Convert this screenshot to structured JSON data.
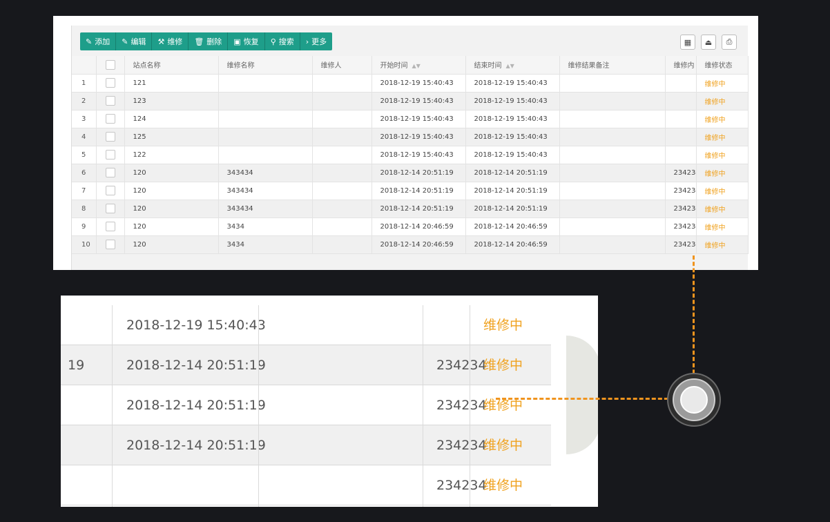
{
  "toolbar": [
    {
      "icon": "✎",
      "label": "添加",
      "name": "add-button",
      "icon_name": "pencil-icon"
    },
    {
      "icon": "✎",
      "label": "编辑",
      "name": "edit-button",
      "icon_name": "pencil-icon"
    },
    {
      "icon": "⚒",
      "label": "维修",
      "name": "repair-button",
      "icon_name": "wrench-icon"
    },
    {
      "icon": "🗑",
      "label": "删除",
      "name": "delete-button",
      "icon_name": "trash-icon"
    },
    {
      "icon": "▣",
      "label": "恢复",
      "name": "restore-button",
      "icon_name": "restore-icon"
    },
    {
      "icon": "⚲",
      "label": "搜索",
      "name": "search-button",
      "icon_name": "search-icon"
    },
    {
      "icon": "›",
      "label": "更多",
      "name": "more-button",
      "icon_name": "chevron-right-icon"
    }
  ],
  "right_tools": [
    {
      "icon": "▦",
      "name": "columns-button",
      "icon_name": "grid-icon"
    },
    {
      "icon": "⏏",
      "name": "export-button",
      "icon_name": "export-icon"
    },
    {
      "icon": "⎙",
      "name": "print-button",
      "icon_name": "print-icon"
    }
  ],
  "table": {
    "headers": [
      "",
      "",
      "站点名称",
      "维修名称",
      "维修人",
      "开始时间",
      "结束时间",
      "维修结果备注",
      "维修内",
      "维修状态"
    ],
    "rows": [
      [
        "1",
        "121",
        "",
        "",
        "2018-12-19 15:40:43",
        "2018-12-19 15:40:43",
        "",
        "",
        "维修中"
      ],
      [
        "2",
        "123",
        "",
        "",
        "2018-12-19 15:40:43",
        "2018-12-19 15:40:43",
        "",
        "",
        "维修中"
      ],
      [
        "3",
        "124",
        "",
        "",
        "2018-12-19 15:40:43",
        "2018-12-19 15:40:43",
        "",
        "",
        "维修中"
      ],
      [
        "4",
        "125",
        "",
        "",
        "2018-12-19 15:40:43",
        "2018-12-19 15:40:43",
        "",
        "",
        "维修中"
      ],
      [
        "5",
        "122",
        "",
        "",
        "2018-12-19 15:40:43",
        "2018-12-19 15:40:43",
        "",
        "",
        "维修中"
      ],
      [
        "6",
        "120",
        "343434",
        "",
        "2018-12-14 20:51:19",
        "2018-12-14 20:51:19",
        "",
        "234234",
        "维修中"
      ],
      [
        "7",
        "120",
        "343434",
        "",
        "2018-12-14 20:51:19",
        "2018-12-14 20:51:19",
        "",
        "234234",
        "维修中"
      ],
      [
        "8",
        "120",
        "343434",
        "",
        "2018-12-14 20:51:19",
        "2018-12-14 20:51:19",
        "",
        "234234",
        "维修中"
      ],
      [
        "9",
        "120",
        "3434",
        "",
        "2018-12-14 20:46:59",
        "2018-12-14 20:46:59",
        "",
        "234234",
        "维修中"
      ],
      [
        "10",
        "120",
        "3434",
        "",
        "2018-12-14 20:46:59",
        "2018-12-14 20:46:59",
        "",
        "234234",
        "维修中"
      ]
    ]
  },
  "zoom": {
    "rows": [
      {
        "left": "",
        "time": "2018-12-19 15:40:43",
        "content": "",
        "status": "维修中"
      },
      {
        "left": "19",
        "time": "2018-12-14 20:51:19",
        "content": "234234",
        "status": "维修中"
      },
      {
        "left": "",
        "time": "2018-12-14 20:51:19",
        "content": "234234",
        "status": "维修中"
      },
      {
        "left": "",
        "time": "2018-12-14 20:51:19",
        "content": "234234",
        "status": "维修中"
      },
      {
        "left": "",
        "time": "",
        "content": "234234",
        "status": "维修中"
      }
    ]
  },
  "colors": {
    "accent": "#1e9e8a",
    "status": "#f0a21f",
    "connector": "#f0941e"
  }
}
